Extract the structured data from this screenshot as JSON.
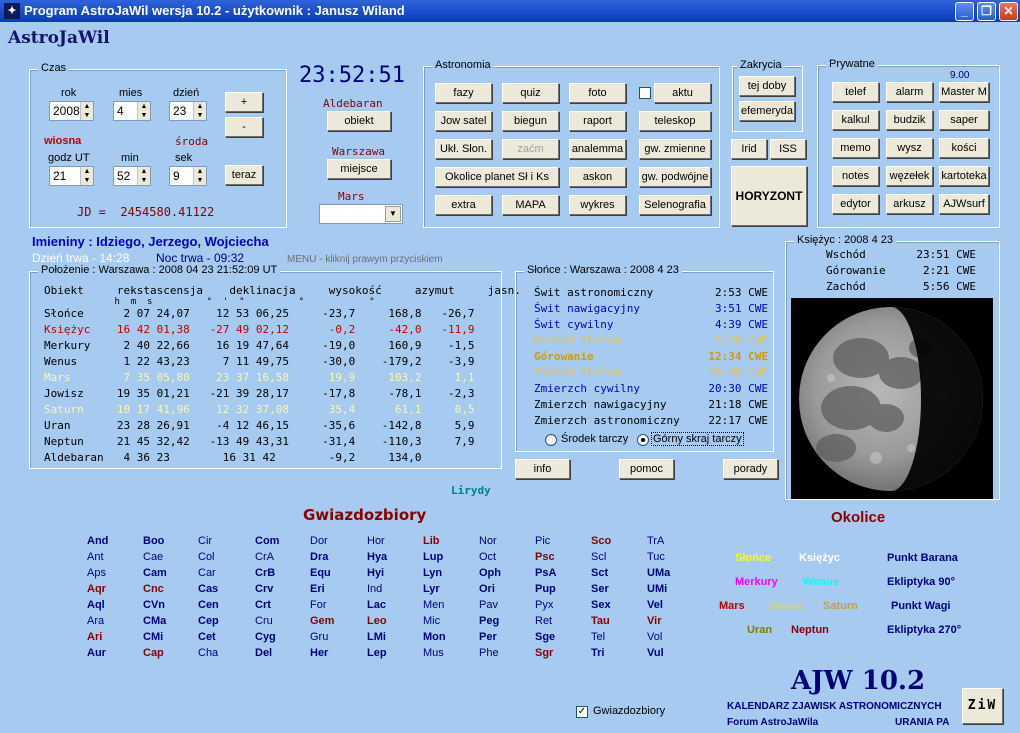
{
  "window": {
    "title": "Program AstroJaWil wersja 10.2 - użytkownik : Janusz Wiland",
    "app_icon": "star-icon",
    "min": "_",
    "max": "❐",
    "close": "✕"
  },
  "app_name": "AstroJaWil",
  "czas": {
    "group": "Czas",
    "rok_label": "rok",
    "mies_label": "mies",
    "dzien_label": "dzień",
    "rok": "2008",
    "mies": "4",
    "dzien": "23",
    "plus": "+",
    "minus": "-",
    "season": "wiosna",
    "weekday": "środa",
    "godz_label": "godz UT",
    "min_label": "min",
    "sek_label": "sek",
    "godz": "21",
    "min": "52",
    "sek": "9",
    "teraz": "teraz",
    "jd": "JD =  2454580.41122"
  },
  "clock": "23:52:51",
  "obiekt_name": "Aldebaran",
  "obiekt_btn": "obiekt",
  "miejsce_name": "Warszawa",
  "miejsce_btn": "miejsce",
  "planet_name": "Mars",
  "planet_select": "",
  "astronomia": {
    "group": "Astronomia",
    "buttons": [
      "fazy",
      "quiz",
      "foto",
      "aktu",
      "Jow satel",
      "biegun",
      "raport",
      "teleskop",
      "Ukł. Słon.",
      "zaćm",
      "analemma",
      "gw. zmienne",
      "Okolice planet Sł i Ks",
      "askon",
      "gw. podwójne",
      "extra",
      "MAPA",
      "wykres",
      "Selenografia"
    ]
  },
  "zakrycia": {
    "group": "Zakrycia",
    "b1": "tej doby",
    "b2": "efemeryda"
  },
  "iss": {
    "irid": "Irid",
    "iss": "ISS",
    "horyzont": "HORYZONT"
  },
  "prywatne": {
    "group": "Prywatne",
    "version": "9.00",
    "buttons": [
      "telef",
      "alarm",
      "Master M",
      "kalkul",
      "budzik",
      "saper",
      "memo",
      "wysz",
      "kości",
      "notes",
      "węzełek",
      "kartoteka",
      "edytor",
      "arkusz",
      "AJWsurf"
    ]
  },
  "imieniny": "Imieniny : Idziego, Jerzego, Wojciecha",
  "dzien_trwa": "Dzień trwa - 14:28",
  "noc_trwa": "Noc trwa - 09:32",
  "menu_hint": "MENU - kliknij prawym przyciskiem",
  "polozenie": {
    "title": "Położenie : Warszawa : 2008 04 23   21:52:09 UT",
    "header1": "Obiekt     rekstascensja    deklinacja     wysokość     azymut     jasn.",
    "header2": "             h  m  s          °  '  \"          °            °",
    "rows": [
      {
        "t": "Słońce      2 07 24,07    12 53 06,25     -23,7     168,8   -26,7",
        "c": "#000"
      },
      {
        "t": "Księżyc    16 42 01,38   -27 49 02,12      -0,2     -42,0   -11,9",
        "c": "#c00000"
      },
      {
        "t": "Merkury     2 40 22,66    16 19 47,64     -19,0     160,9    -1,5",
        "c": "#000"
      },
      {
        "t": "Wenus       1 22 43,23     7 11 49,75     -30,0    -179,2    -3,9",
        "c": "#000"
      },
      {
        "t": "Mars        7 35 05,80    23 37 16,58      19,9     103,2     1,1",
        "c": "#f8f8b0"
      },
      {
        "t": "Jowisz     19 35 01,21   -21 39 28,17     -17,8     -78,1    -2,3",
        "c": "#000"
      },
      {
        "t": "Saturn     10 17 41,96    12 32 37,08      35,4      61,1     0,5",
        "c": "#f8f8b0"
      },
      {
        "t": "Uran       23 28 26,91    -4 12 46,15     -35,6    -142,8     5,9",
        "c": "#000"
      },
      {
        "t": "Neptun     21 45 32,42   -13 49 43,31     -31,4    -110,3     7,9",
        "c": "#000"
      },
      {
        "t": "Aldebaran   4 36 23        16 31 42        -9,2     134,0",
        "c": "#000"
      }
    ]
  },
  "lirydy": "Lirydy",
  "slonce": {
    "title": "Słońce : Warszawa : 2008  4  23",
    "rows": [
      {
        "n": "Świt astronomiczny",
        "v": "2:53  CWE",
        "c": "#000"
      },
      {
        "n": "Świt nawigacyjny",
        "v": "3:51  CWE",
        "c": "#0000c8"
      },
      {
        "n": "Świt cywilny",
        "v": "4:39  CWE",
        "c": "#0000c8"
      },
      {
        "n": "Wschód Słońca",
        "v": "5:20  CWE",
        "c": "#e6c25a"
      },
      {
        "n": "Górowanie",
        "v": "12:34  CWE",
        "c": "#d69a00"
      },
      {
        "n": "Zachód Słońca",
        "v": "19:48  CWE",
        "c": "#e6c25a"
      },
      {
        "n": "Zmierzch cywilny",
        "v": "20:30  CWE",
        "c": "#0000c8"
      },
      {
        "n": "Zmierzch nawigacyjny",
        "v": "21:18  CWE",
        "c": "#000"
      },
      {
        "n": "Zmierzch astronomiczny",
        "v": "22:17  CWE",
        "c": "#000"
      }
    ],
    "r1": "Środek tarczy",
    "r2": "Górny skraj tarczy"
  },
  "btns": {
    "info": "info",
    "pomoc": "pomoc",
    "porady": "porady"
  },
  "ksiezyc": {
    "title": "Księżyc : 2008  4  23",
    "rows": [
      {
        "n": "Wschód",
        "v": "23:51  CWE"
      },
      {
        "n": "Górowanie",
        "v": "2:21  CWE"
      },
      {
        "n": "Zachód",
        "v": "5:56  CWE"
      }
    ]
  },
  "gwiazdozbiory_title": "Gwiazdozbiory",
  "constellations": [
    [
      "And",
      "Boo",
      "Cir",
      "Com",
      "Dor",
      "Hor",
      "Lib",
      "Nor",
      "Pic",
      "Sco",
      "TrA"
    ],
    [
      "Ant",
      "Cae",
      "Col",
      "CrA",
      "Dra",
      "Hya",
      "Lup",
      "Oct",
      "Psc",
      "Scl",
      "Tuc"
    ],
    [
      "Aps",
      "Cam",
      "Car",
      "CrB",
      "Equ",
      "Hyi",
      "Lyn",
      "Oph",
      "PsA",
      "Sct",
      "UMa"
    ],
    [
      "Aqr",
      "Cnc",
      "Cas",
      "Crv",
      "Eri",
      "Ind",
      "Lyr",
      "Ori",
      "Pup",
      "Ser",
      "UMi"
    ],
    [
      "Aql",
      "CVn",
      "Cen",
      "Crt",
      "For",
      "Lac",
      "Men",
      "Pav",
      "Pyx",
      "Sex",
      "Vel"
    ],
    [
      "Ara",
      "CMa",
      "Cep",
      "Cru",
      "Gem",
      "Leo",
      "Mic",
      "Peg",
      "Ret",
      "Tau",
      "Vir"
    ],
    [
      "Ari",
      "CMi",
      "Cet",
      "Cyg",
      "Gru",
      "LMi",
      "Mon",
      "Per",
      "Sge",
      "Tel",
      "Vol"
    ],
    [
      "Aur",
      "Cap",
      "Cha",
      "Del",
      "Her",
      "Lep",
      "Mus",
      "Phe",
      "Sgr",
      "Tri",
      "Vul"
    ]
  ],
  "constellation_styles": [
    [
      "b",
      "b",
      "n",
      "b",
      "n",
      "n",
      "r",
      "n",
      "n",
      "r",
      "n"
    ],
    [
      "n",
      "n",
      "n",
      "n",
      "b",
      "b",
      "b",
      "n",
      "r",
      "n",
      "n"
    ],
    [
      "n",
      "b",
      "n",
      "b",
      "b",
      "b",
      "b",
      "b",
      "b",
      "b",
      "b"
    ],
    [
      "r",
      "r",
      "b",
      "b",
      "b",
      "n",
      "b",
      "b",
      "b",
      "b",
      "b"
    ],
    [
      "b",
      "b",
      "b",
      "b",
      "n",
      "b",
      "n",
      "n",
      "n",
      "b",
      "b"
    ],
    [
      "n",
      "b",
      "b",
      "n",
      "r",
      "r",
      "n",
      "b",
      "n",
      "r",
      "r"
    ],
    [
      "r",
      "b",
      "b",
      "b",
      "n",
      "b",
      "b",
      "b",
      "b",
      "n",
      "n"
    ],
    [
      "b",
      "r",
      "n",
      "b",
      "b",
      "b",
      "n",
      "n",
      "r",
      "b",
      "b"
    ]
  ],
  "gwiazdozbiory_check": "Gwiazdozbiory",
  "okolice": {
    "title": "Okolice",
    "slonce": "Słońce",
    "ksiezyc": "Księżyc",
    "punkt_barana": "Punkt Barana",
    "merkury": "Merkury",
    "wenus": "Wenus",
    "ekl90": "Ekliptyka 90°",
    "mars": "Mars",
    "jowisz": "Jowisz",
    "saturn": "Saturn",
    "punkt_wagi": "Punkt Wagi",
    "uran": "Uran",
    "neptun": "Neptun",
    "ekl270": "Ekliptyka 270°"
  },
  "footer": {
    "ajw": "AJW 10.2",
    "kal": "KALENDARZ ZJAWISK ASTRONOMICZNYCH",
    "forum": "Forum AstroJaWila",
    "urania": "URANIA PA",
    "ziw": "ZiW"
  },
  "colors": {
    "bg": "#a6caf0",
    "accent": "#13136a"
  }
}
